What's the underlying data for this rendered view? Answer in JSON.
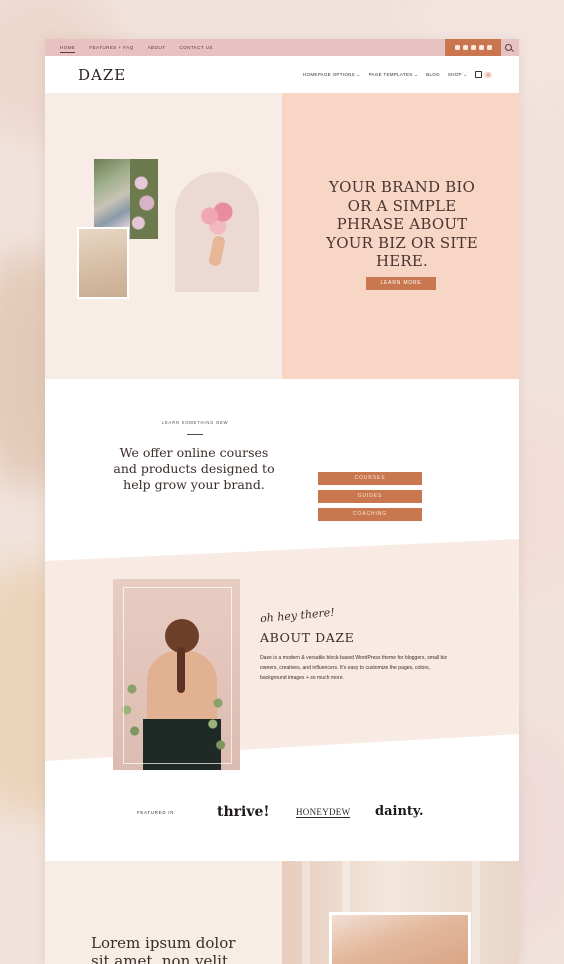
{
  "topbar": {
    "nav": [
      "HOME",
      "FEATURES + FAQ",
      "ABOUT",
      "CONTACT US"
    ]
  },
  "header": {
    "logo": "DAZE",
    "nav": [
      "HOMEPAGE OPTIONS ⌄",
      "PAGE TEMPLATES ⌄",
      "BLOG",
      "SHOP ⌄"
    ],
    "cart_count": "0"
  },
  "hero": {
    "text": "YOUR BRAND BIO OR A SIMPLE PHRASE ABOUT YOUR BIZ OR SITE HERE.",
    "button": "LEARN MORE"
  },
  "offers": {
    "eyebrow": "LEARN SOMETHING NEW",
    "text": "We offer online courses and products designed to help grow your brand.",
    "buttons": [
      "COURSES",
      "GUIDES",
      "COACHING"
    ]
  },
  "about": {
    "script": "oh hey there!",
    "title": "ABOUT DAZE",
    "body": "Daze is a modern & versatile block-based WordPress theme for bloggers, small biz owners, creatives, and influencers. It's easy to customize the pages, colors, background images + so much more."
  },
  "featured": {
    "label": "FEATURED IN:",
    "logos": [
      "thrive!",
      "HONEYDEW",
      "dainty."
    ]
  },
  "bottom": {
    "text": "Lorem ipsum dolor sit amet, non velit &"
  },
  "colors": {
    "accent": "#c9774f",
    "topbar": "#e7c2c3",
    "hero_right": "#f7d6c5",
    "cream": "#f7ede6"
  }
}
